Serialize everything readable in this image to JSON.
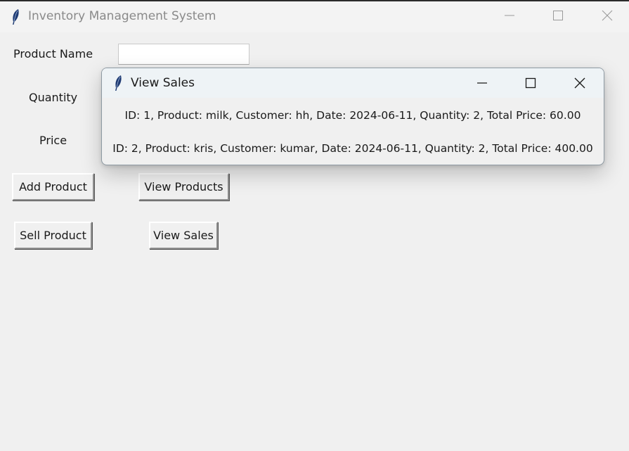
{
  "main_window": {
    "title": "Inventory Management System",
    "controls": {
      "minimize_icon": "minimize-icon",
      "maximize_icon": "maximize-icon",
      "close_icon": "close-icon"
    },
    "app_icon": "feather-icon"
  },
  "form": {
    "product_name_label": "Product Name",
    "product_name_value": "",
    "quantity_label": "Quantity",
    "price_label": "Price"
  },
  "buttons": {
    "add_product": "Add Product",
    "view_products": "View Products",
    "sell_product": "Sell Product",
    "view_sales": "View Sales"
  },
  "sales_window": {
    "title": "View Sales",
    "app_icon": "feather-icon",
    "sales": [
      "ID: 1, Product: milk, Customer: hh, Date: 2024-06-11, Quantity: 2, Total Price: 60.00",
      "ID: 2, Product: kris, Customer: kumar, Date: 2024-06-11, Quantity: 2, Total Price: 400.00"
    ]
  },
  "colors": {
    "window_bg": "#f0f0f0",
    "popup_titlebar_bg": "#eef3f6",
    "inactive_title_text": "#8a8a8a",
    "feather_blue": "#1f3b73"
  }
}
